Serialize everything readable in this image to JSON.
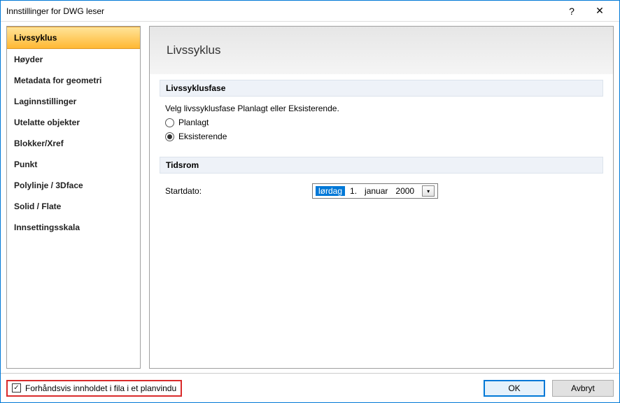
{
  "window": {
    "title": "Innstillinger for DWG leser"
  },
  "sidebar": {
    "items": [
      {
        "label": "Livssyklus",
        "active": true
      },
      {
        "label": "Høyder"
      },
      {
        "label": "Metadata for geometri"
      },
      {
        "label": "Laginnstillinger"
      },
      {
        "label": "Utelatte objekter"
      },
      {
        "label": "Blokker/Xref"
      },
      {
        "label": "Punkt"
      },
      {
        "label": "Polylinje / 3Dface"
      },
      {
        "label": "Solid / Flate"
      },
      {
        "label": "Innsettingsskala"
      }
    ]
  },
  "content": {
    "heading": "Livssyklus",
    "phase": {
      "section_title": "Livssyklusfase",
      "instruction": "Velg livssyklusfase Planlagt eller Eksisterende.",
      "options": {
        "planned": "Planlagt",
        "existing": "Eksisterende"
      },
      "selected": "existing"
    },
    "period": {
      "section_title": "Tidsrom",
      "startdate_label": "Startdato:",
      "date": {
        "weekday": "lørdag",
        "day": "1.",
        "month": "januar",
        "year": "2000"
      }
    }
  },
  "footer": {
    "preview_label": "Forhåndsvis innholdet i fila i et planvindu",
    "preview_checked": true,
    "ok": "OK",
    "cancel": "Avbryt"
  }
}
